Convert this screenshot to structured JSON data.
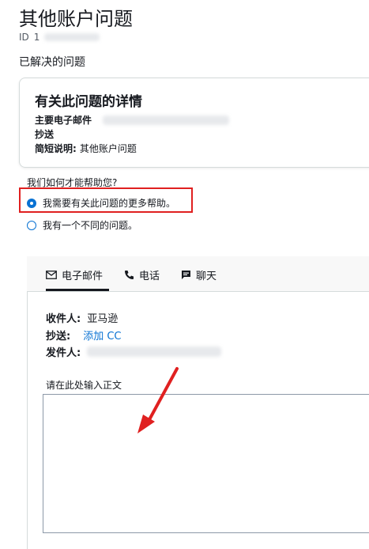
{
  "header": {
    "title": "其他账户问题",
    "case_id_label": "ID",
    "case_id_value": "1",
    "status": "已解决的问题"
  },
  "details": {
    "title": "有关此问题的详情",
    "primary_email_label": "主要电子邮件",
    "cc_label": "抄送",
    "summary_label": "简短说明:",
    "summary_value": "其他账户问题"
  },
  "help": {
    "question": "我们如何才能帮助您?",
    "options": [
      {
        "label": "我需要有关此问题的更多帮助。",
        "selected": true
      },
      {
        "label": "我有一个不同的问题。",
        "selected": false
      }
    ]
  },
  "contact": {
    "tabs": [
      {
        "label": "电子邮件",
        "icon": "mail-icon",
        "active": true
      },
      {
        "label": "电话",
        "icon": "phone-icon",
        "active": false
      },
      {
        "label": "聊天",
        "icon": "chat-icon",
        "active": false
      }
    ],
    "to_label": "收件人:",
    "to_value": "亚马逊",
    "cc_label": "抄送:",
    "add_cc": "添加 CC",
    "from_label": "发件人:",
    "body_label": "请在此处输入正文",
    "body_value": ""
  },
  "colors": {
    "accent": "#0972d3",
    "highlight": "#e02020",
    "text": "#16191f"
  }
}
